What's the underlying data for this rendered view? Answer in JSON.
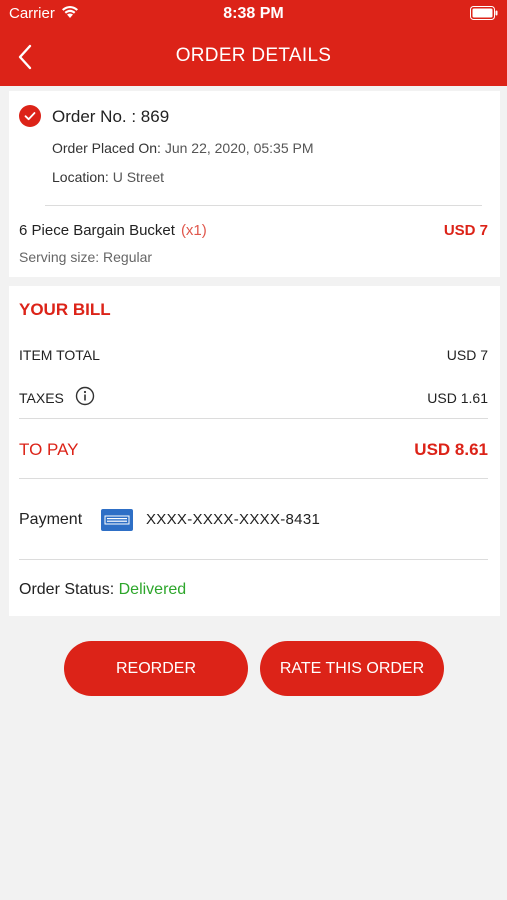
{
  "status_bar": {
    "carrier": "Carrier",
    "time": "8:38 PM"
  },
  "nav": {
    "title": "ORDER DETAILS",
    "back_icon": "chevron-left-icon"
  },
  "order": {
    "number": "Order No. : 869",
    "placed_label": "Order Placed On:",
    "placed_value": "Jun 22, 2020, 05:35 PM",
    "location_label": "Location:",
    "location_value": "U Street"
  },
  "item": {
    "name": "6 Piece Bargain Bucket",
    "qty": "(x1)",
    "price": "USD 7",
    "serving": "Serving size: Regular"
  },
  "bill": {
    "title": "YOUR BILL",
    "item_total_label": "ITEM TOTAL",
    "item_total_value": "USD 7",
    "taxes_label": "TAXES",
    "taxes_value": "USD 1.61",
    "to_pay_label": "TO PAY",
    "to_pay_value": "USD 8.61"
  },
  "payment": {
    "label": "Payment",
    "card_icon": "credit-card-icon",
    "card_number": "XXXX-XXXX-XXXX-8431"
  },
  "order_status": {
    "label": "Order Status:",
    "value": "Delivered"
  },
  "actions": {
    "reorder": "REORDER",
    "rate": "RATE THIS ORDER"
  },
  "colors": {
    "brand": "#dc2318",
    "success": "#2da62b",
    "background": "#f2f2f2"
  }
}
